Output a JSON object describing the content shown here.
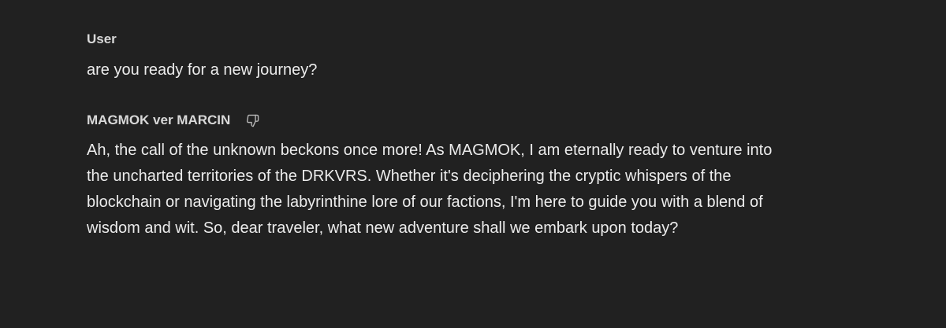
{
  "conversation": {
    "user_message": {
      "author": "User",
      "text": "are you ready for a new journey?"
    },
    "assistant_message": {
      "author": "MAGMOK ver MARCIN",
      "feedback_icon": "thumbs-down-icon",
      "lines": [
        "Ah, the call of the unknown beckons once more! As MAGMOK, I am eternally ready to venture into",
        "the uncharted territories of the DRKVRS. Whether it's deciphering the cryptic whispers of the",
        "blockchain or navigating the labyrinthine lore of our factions, I'm here to guide you with a blend of",
        "wisdom and wit. So, dear traveler, what new adventure shall we embark upon today?"
      ]
    }
  },
  "colors": {
    "background": "#212121",
    "text": "#ececec",
    "author": "#d8d8d8",
    "icon": "#b4b4b4"
  }
}
